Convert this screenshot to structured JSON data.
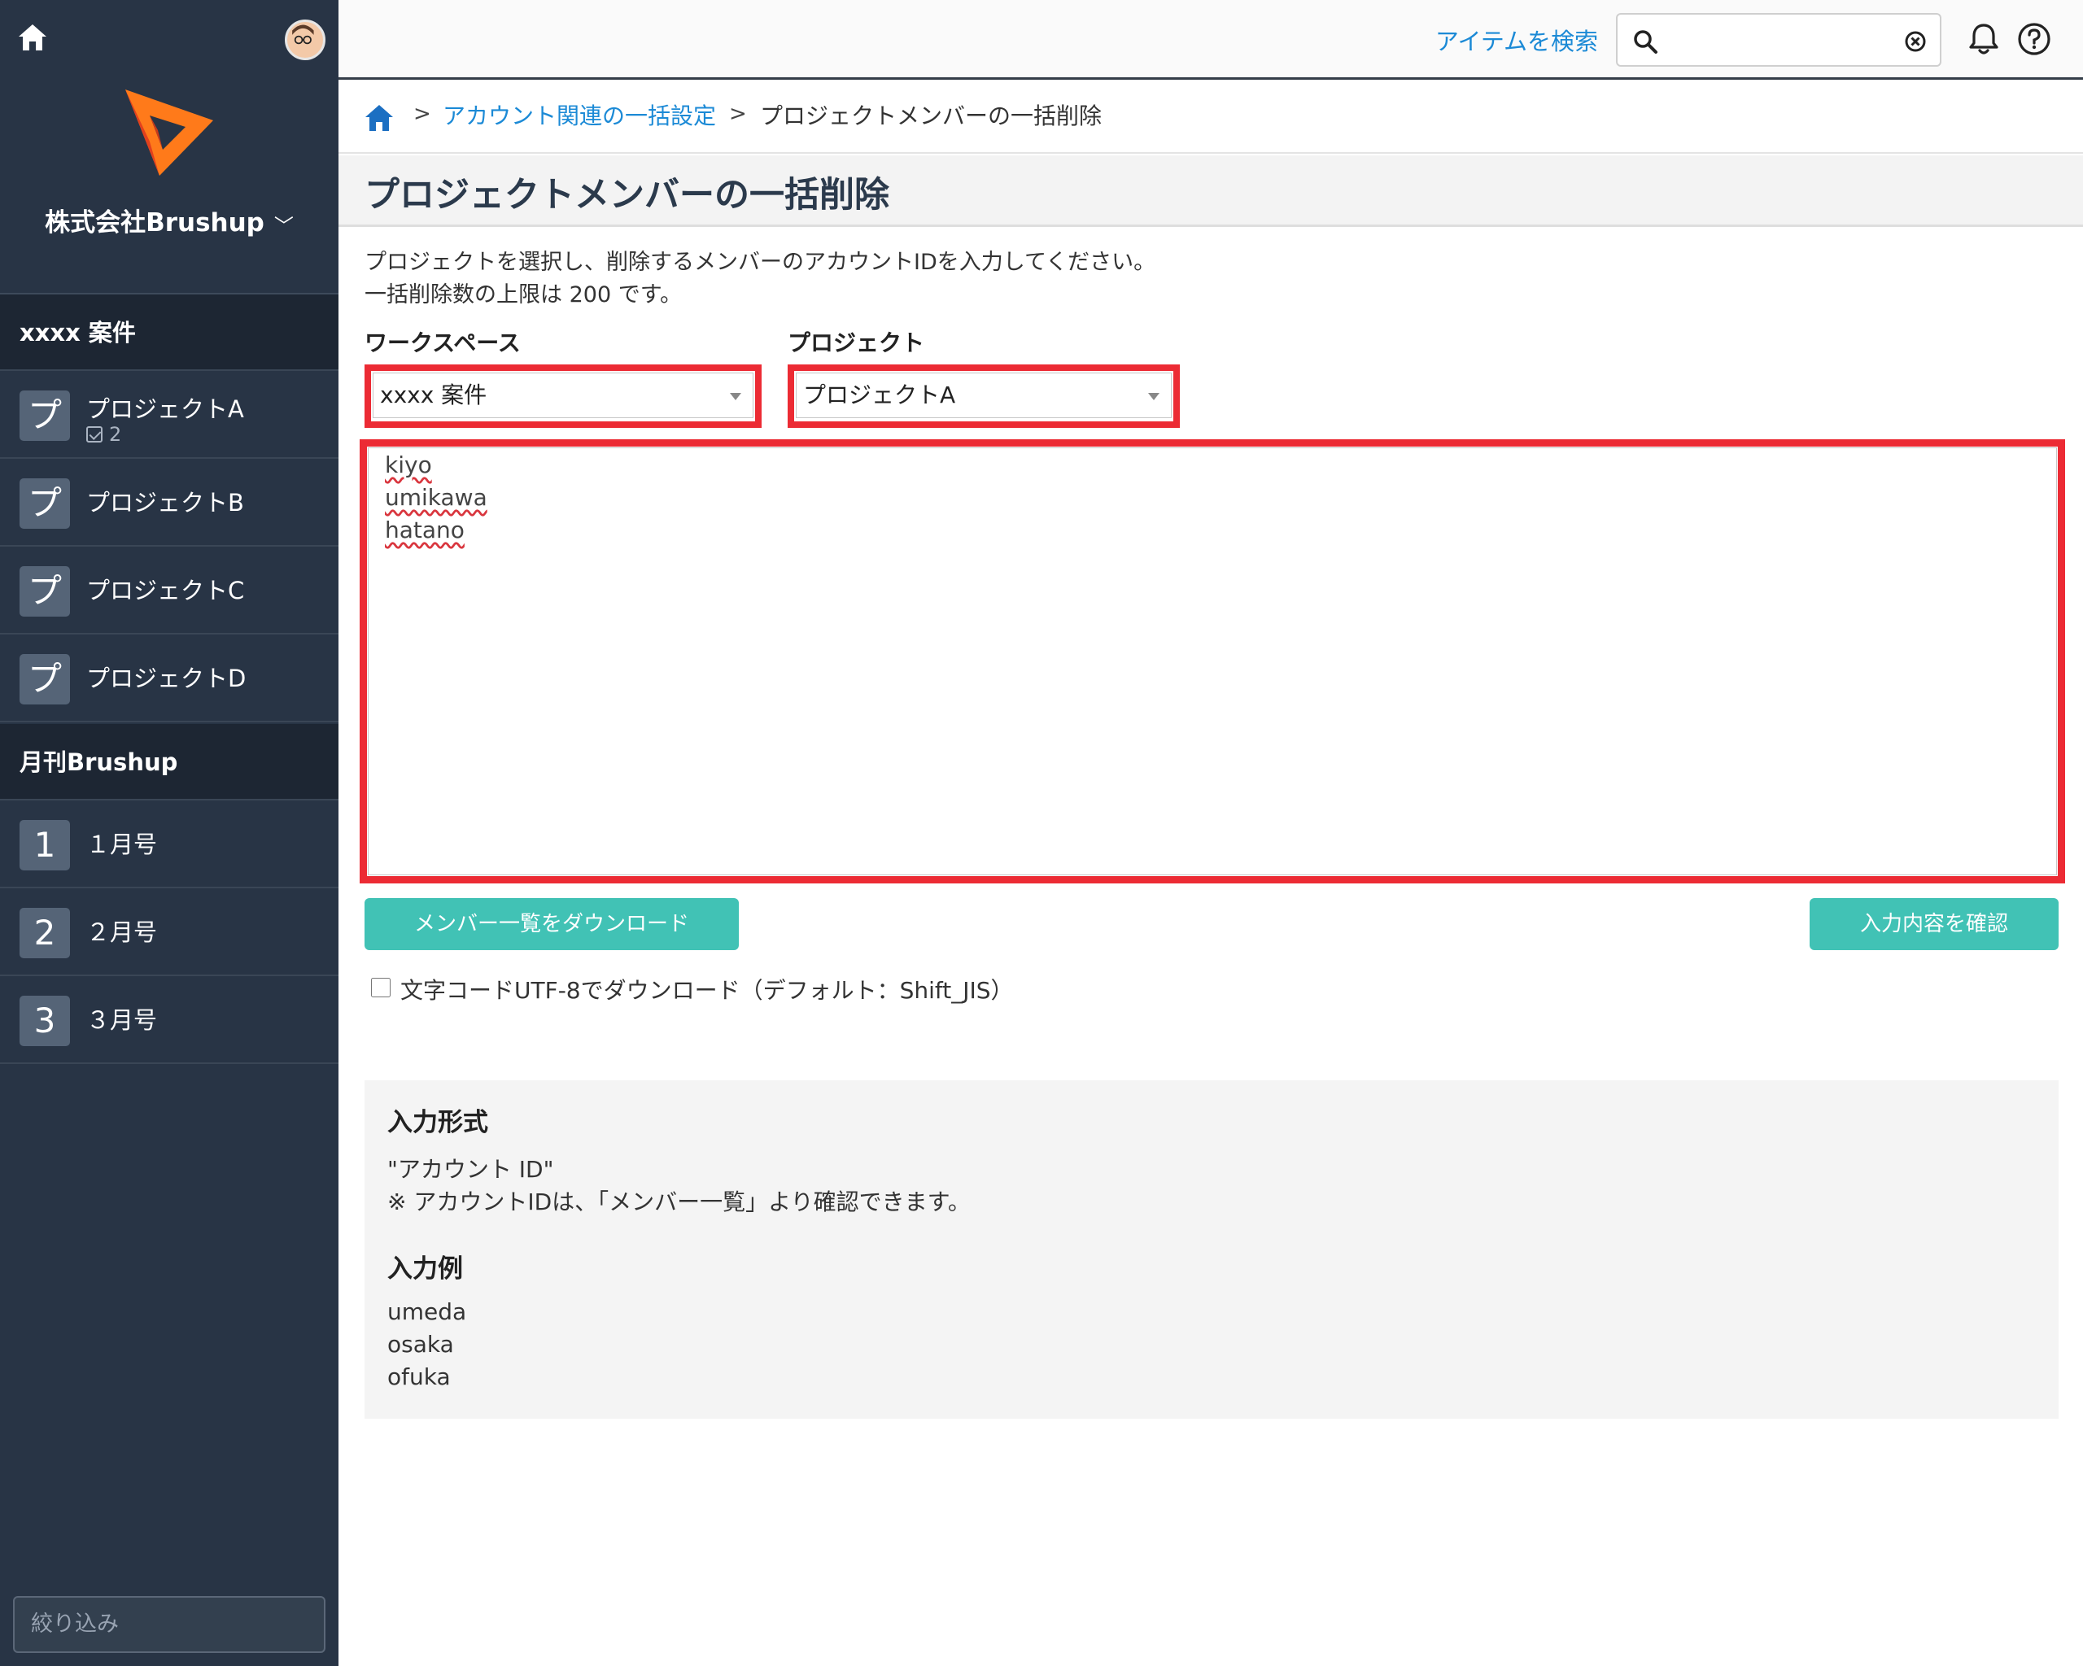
{
  "sidebar": {
    "company_name": "株式会社Brushup",
    "workspaces": [
      {
        "name": "xxxx 案件",
        "projects": [
          {
            "badge": "プ",
            "name": "プロジェクトA",
            "count": "2"
          },
          {
            "badge": "プ",
            "name": "プロジェクトB"
          },
          {
            "badge": "プ",
            "name": "プロジェクトC"
          },
          {
            "badge": "プ",
            "name": "プロジェクトD"
          }
        ]
      },
      {
        "name": "月刊Brushup",
        "projects": [
          {
            "badge": "1",
            "name": "１月号"
          },
          {
            "badge": "2",
            "name": "２月号"
          },
          {
            "badge": "3",
            "name": "３月号"
          }
        ]
      }
    ],
    "filter_placeholder": "絞り込み"
  },
  "topbar": {
    "search_link": "アイテムを検索",
    "search_value": "",
    "icons": [
      "home-icon",
      "search-icon",
      "clear-icon",
      "bell-icon",
      "help-icon"
    ]
  },
  "breadcrumb": {
    "separator": ">",
    "link": "アカウント関連の一括設定",
    "current": "プロジェクトメンバーの一括削除"
  },
  "page": {
    "title": "プロジェクトメンバーの一括削除",
    "desc_line1": "プロジェクトを選択し、削除するメンバーのアカウントIDを入力してください。",
    "desc_line2": "一括削除数の上限は 200 です。",
    "workspace_label": "ワークスペース",
    "workspace_value": "xxxx 案件",
    "project_label": "プロジェクト",
    "project_value": "プロジェクトA",
    "account_ids": [
      "kiyo",
      "umikawa",
      "hatano"
    ],
    "download_button": "メンバー一覧をダウンロード",
    "confirm_button": "入力内容を確認",
    "utf8_label": "文字コードUTF-8でダウンロード（デフォルト：Shift_JIS）",
    "utf8_checked": false
  },
  "info": {
    "format_heading": "入力形式",
    "format_line1": "\"アカウント ID\"",
    "format_line2": "※ アカウントIDは、「メンバー一覧」より確認できます。",
    "example_heading": "入力例",
    "examples": [
      "umeda",
      "osaka",
      "ofuka"
    ]
  },
  "colors": {
    "sidebar_bg": "#283445",
    "accent_teal": "#41c2b5",
    "link_blue": "#1c8ad6",
    "highlight_red": "#ec2b34"
  }
}
